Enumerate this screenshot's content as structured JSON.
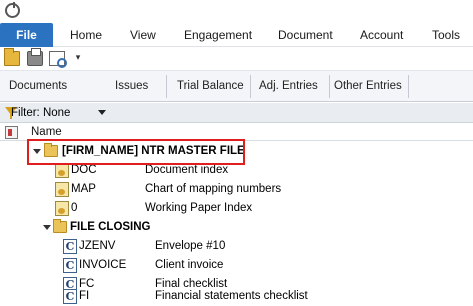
{
  "menubar": {
    "file": "File",
    "items": [
      "Home",
      "View",
      "Engagement",
      "Document",
      "Account",
      "Tools"
    ]
  },
  "quickbar": {
    "icons": [
      "open-icon",
      "print-icon",
      "print-preview-icon"
    ],
    "more_glyph": "▾"
  },
  "tabs": [
    "Documents",
    "Issues",
    "Trial Balance",
    "Adj. Entries",
    "Other Entries"
  ],
  "filter": {
    "label": "Filter: None"
  },
  "column_header": {
    "name": "Name"
  },
  "tree": {
    "root": {
      "label": "[FIRM_NAME] NTR MASTER FILE",
      "expanded": true
    },
    "root_docs": [
      {
        "code": "DOC",
        "description": "Document index"
      },
      {
        "code": "MAP",
        "description": "Chart of mapping numbers"
      },
      {
        "code": "0",
        "description": "Working Paper Index"
      }
    ],
    "subfolder": {
      "label": "FILE CLOSING",
      "expanded": true
    },
    "subfolder_docs": [
      {
        "code": "JZENV",
        "description": "Envelope #10"
      },
      {
        "code": "INVOICE",
        "description": "Client invoice"
      },
      {
        "code": "FC",
        "description": "Final checklist"
      },
      {
        "code": "FI",
        "description": "Financial statements checklist"
      }
    ]
  },
  "colors": {
    "file_tab": "#2b73c0",
    "highlight_border": "#e01e1e",
    "filter_bar": "#e9edf2"
  }
}
